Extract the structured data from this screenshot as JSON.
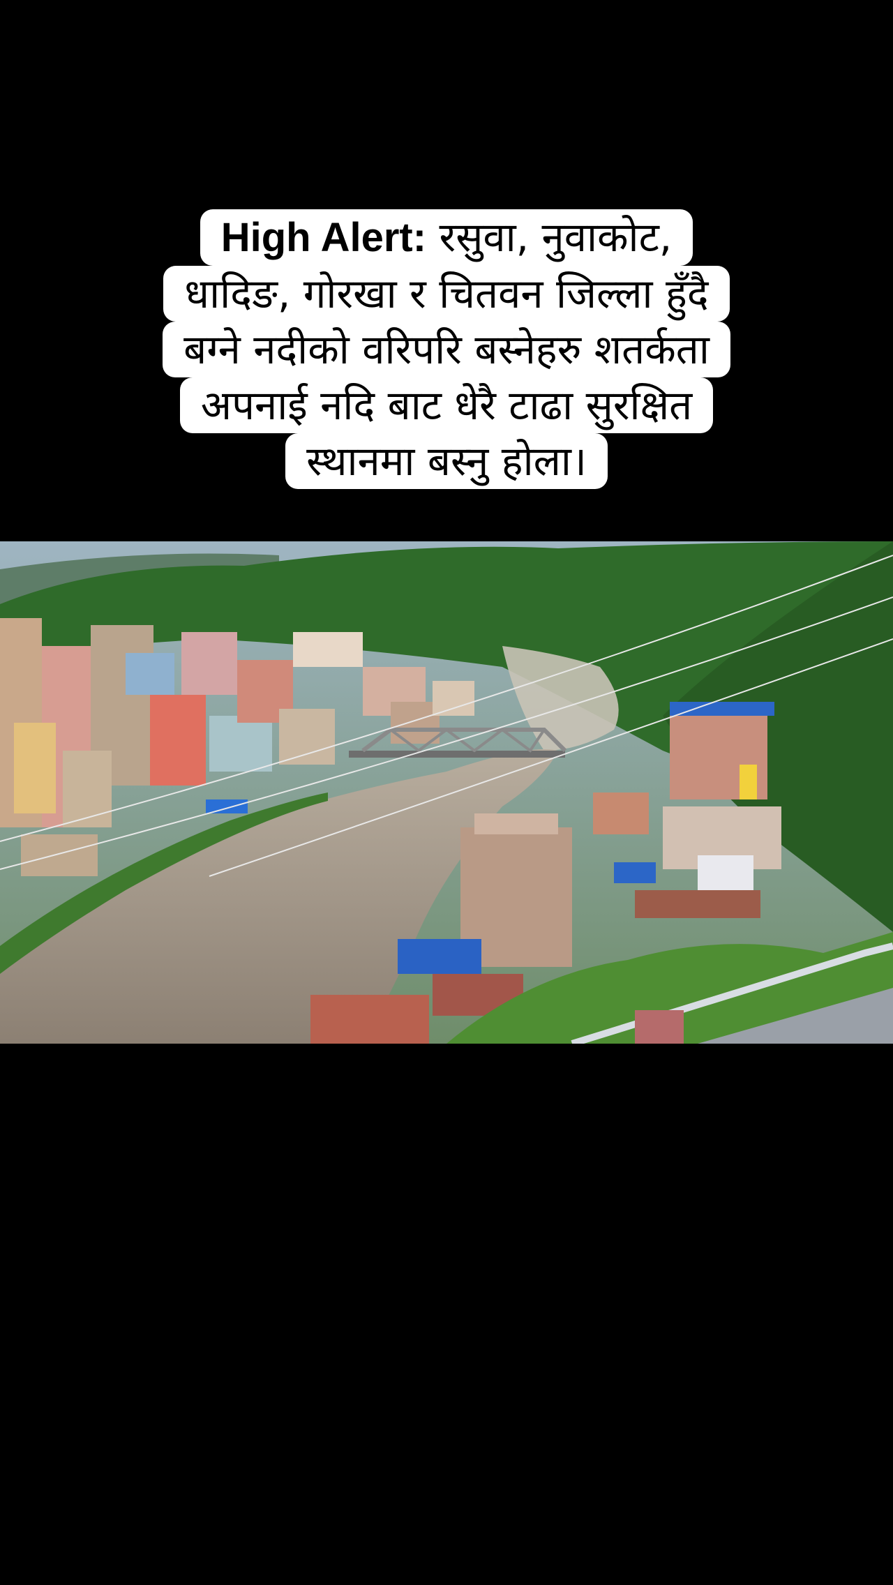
{
  "caption": {
    "lines": [
      {
        "bold": "High Alert:",
        "text": " रसुवा, नुवाकोट,"
      },
      {
        "bold": "",
        "text": "धादिङ, गोरखा र चितवन जिल्ला हुँदै"
      },
      {
        "bold": "",
        "text": "बग्ने नदीको वरिपरि बस्नेहरु शतर्कता"
      },
      {
        "bold": "",
        "text": "अपनाई नदि बाट धेरै टाढा सुरक्षित"
      },
      {
        "bold": "",
        "text": "स्थानमा बस्नु होला।"
      }
    ]
  },
  "colors": {
    "background": "#000000",
    "caption_bg": "#ffffff",
    "river": "#9b8f80",
    "forest": "#2f6b2a"
  }
}
